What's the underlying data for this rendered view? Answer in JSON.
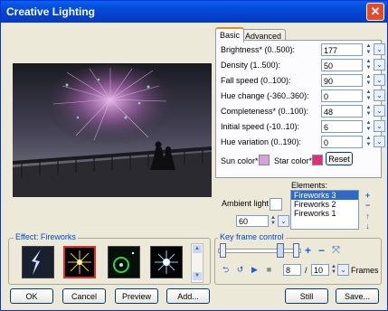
{
  "window": {
    "title": "Creative Lighting"
  },
  "effect": {
    "group_label": "Effect: Fireworks",
    "thumbnails": [
      {
        "name": "lightning"
      },
      {
        "name": "fireworks"
      },
      {
        "name": "glow-ring"
      },
      {
        "name": "starburst"
      }
    ]
  },
  "ambient": {
    "label": "Ambient light",
    "value": "60"
  },
  "tabs": [
    {
      "label": "Basic"
    },
    {
      "label": "Advanced"
    }
  ],
  "basic": {
    "rows": [
      {
        "label": "Brightness* (0..500):",
        "value": "177"
      },
      {
        "label": "Density (1..500):",
        "value": "50"
      },
      {
        "label": "Fall speed (0..100):",
        "value": "90"
      },
      {
        "label": "Hue change (-360..360):",
        "value": "0"
      },
      {
        "label": "Completeness* (0..100):",
        "value": "48"
      },
      {
        "label": "Initial speed (-10..10):",
        "value": "6"
      },
      {
        "label": "Hue variation (0..190):",
        "value": "0"
      }
    ],
    "sun_color_label": "Sun color*",
    "sun_color": "#d8a0e0",
    "star_color_label": "Star color*",
    "star_color": "#e0307c",
    "reset_label": "Reset"
  },
  "elements": {
    "label": "Elements:",
    "items": [
      "Fireworks 3",
      "Fireworks 2",
      "Fireworks 1"
    ],
    "selected_index": 0
  },
  "keyframe": {
    "label": "Key frame control",
    "frame_value": "8",
    "frame_separator": "/",
    "frame_total": "10",
    "frames_label": "Frames"
  },
  "buttons": {
    "ok": "OK",
    "cancel": "Cancel",
    "preview": "Preview",
    "add": "Add...",
    "still": "Still",
    "save": "Save..."
  }
}
